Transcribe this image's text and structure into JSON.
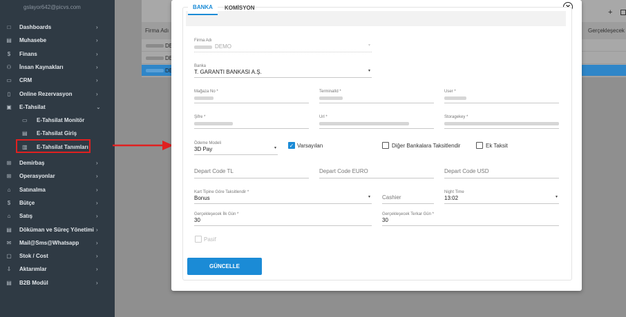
{
  "sidebar": {
    "user": "gslayor642@picvs.com",
    "items": [
      {
        "icon": "□",
        "label": "Dashboards"
      },
      {
        "icon": "▤",
        "label": "Muhasebe"
      },
      {
        "icon": "$",
        "label": "Finans"
      },
      {
        "icon": "⚇",
        "label": "İnsan Kaynakları"
      },
      {
        "icon": "▭",
        "label": "CRM"
      },
      {
        "icon": "▯",
        "label": "Online Rezervasyon"
      },
      {
        "icon": "▣",
        "label": "E-Tahsilat"
      }
    ],
    "sub_items": [
      {
        "icon": "▭",
        "label": "E-Tahsilat Monitör"
      },
      {
        "icon": "▤",
        "label": "E-Tahsilat Giriş"
      },
      {
        "icon": "▥",
        "label": "E-Tahsilat Tanımları"
      }
    ],
    "items_after": [
      {
        "icon": "⊞",
        "label": "Demirbaş"
      },
      {
        "icon": "⊞",
        "label": "Operasyonlar"
      },
      {
        "icon": "⌂",
        "label": "Satınalma"
      },
      {
        "icon": "$",
        "label": "Bütçe"
      },
      {
        "icon": "⌂",
        "label": "Satış"
      },
      {
        "icon": "▤",
        "label": "Döküman ve Süreç Yönetimi"
      },
      {
        "icon": "✉",
        "label": "Mail@Sms@Whatsapp"
      },
      {
        "icon": "▢",
        "label": "Stok / Cost"
      },
      {
        "icon": "⇩",
        "label": "Aktarımlar"
      },
      {
        "icon": "▤",
        "label": "B2B Modül"
      }
    ],
    "chevron": "›",
    "chevron_open": "⌄"
  },
  "background": {
    "col_firma": "Firma Adı",
    "col_gerceklesecek": "Gerçekleşecek",
    "row_cells": [
      "DE",
      "DE",
      "DE"
    ]
  },
  "modal": {
    "tabs": [
      "BANKA",
      "KOMİSYON"
    ],
    "firma_label": "Firma Adı",
    "firma_value": "DEMO",
    "banka_label": "Banka",
    "banka_value": "T. GARANTI BANKASI A.Ş.",
    "magaza_label": "Mağaza No *",
    "terminal_label": "TerminalId *",
    "user_label": "User *",
    "sifre_label": "Şifre *",
    "url_label": "Url *",
    "storage_label": "Storagekey *",
    "odeme_label": "Ödeme Modeli",
    "odeme_value": "3D Pay",
    "varsayilan_label": "Varsayılan",
    "diger_label": "Diğer Bankalara Taksitlendir",
    "ek_taksit_label": "Ek Taksit",
    "depart_tl": "Depart Code TL",
    "depart_euro": "Depart Code EURO",
    "depart_usd": "Depart Code USD",
    "kart_label": "Kart Tipine Göre Taksitlendir *",
    "kart_value": "Bonus",
    "cashier": "Cashier",
    "night_label": "Night Time",
    "night_value": "13:02",
    "ilk_gun_label": "Gerçekleşecek İlk Gün *",
    "ilk_gun_value": "30",
    "terkar_label": "Gerçekleşecek Terkar Gün *",
    "terkar_value": "30",
    "pasif_label": "Pasif",
    "save_label": "GÜNCELLE",
    "close_glyph": "✕",
    "caret_glyph": "▾",
    "check_glyph": "✓"
  },
  "colors": {
    "accent": "#1b8bd6",
    "sidebar_bg": "#2f3a44",
    "highlight": "#e02020"
  }
}
